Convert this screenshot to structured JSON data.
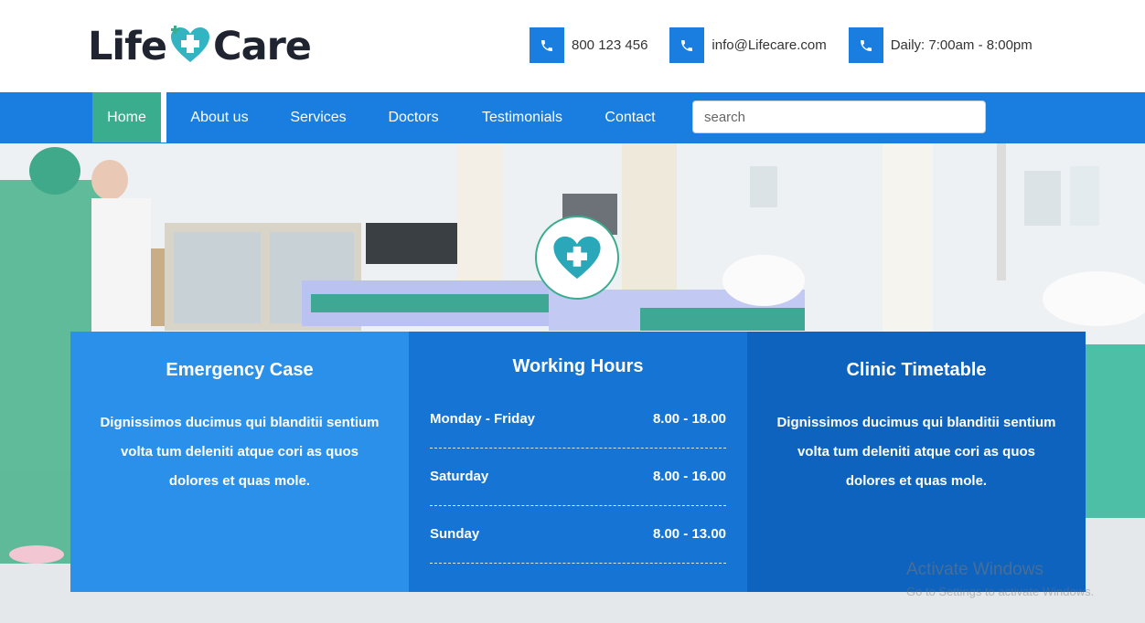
{
  "brand": {
    "name_left": "Life",
    "name_right": "Care"
  },
  "contacts": [
    {
      "icon": "phone-icon",
      "text": "800 123 456"
    },
    {
      "icon": "phone-icon",
      "text": "info@Lifecare.com"
    },
    {
      "icon": "phone-icon",
      "text": "Daily: 7:00am - 8:00pm"
    }
  ],
  "nav": {
    "items": [
      "Home",
      "About us",
      "Services",
      "Doctors",
      "Testimonials",
      "Contact"
    ],
    "active": "Home",
    "search_placeholder": "search"
  },
  "boxes": {
    "emergency": {
      "title": "Emergency Case",
      "text": "Dignissimos ducimus qui blanditii sentium volta tum deleniti atque cori as quos dolores et quas mole."
    },
    "hours": {
      "title": "Working Hours",
      "rows": [
        {
          "day": "Monday - Friday",
          "hours": "8.00 - 18.00"
        },
        {
          "day": "Saturday",
          "hours": "8.00 - 16.00"
        },
        {
          "day": "Sunday",
          "hours": "8.00 - 13.00"
        }
      ]
    },
    "timetable": {
      "title": "Clinic Timetable",
      "text": "Dignissimos ducimus qui blanditii sentium volta tum deleniti atque cori as quos dolores et quas mole."
    }
  },
  "watermark": {
    "title": "Activate Windows",
    "subtitle": "Go to Settings to activate Windows."
  },
  "colors": {
    "primary": "#1a7ee0",
    "accent": "#3aad8e",
    "box1": "#2b90ea",
    "box2": "#1574d4",
    "box3": "#0d63be"
  }
}
